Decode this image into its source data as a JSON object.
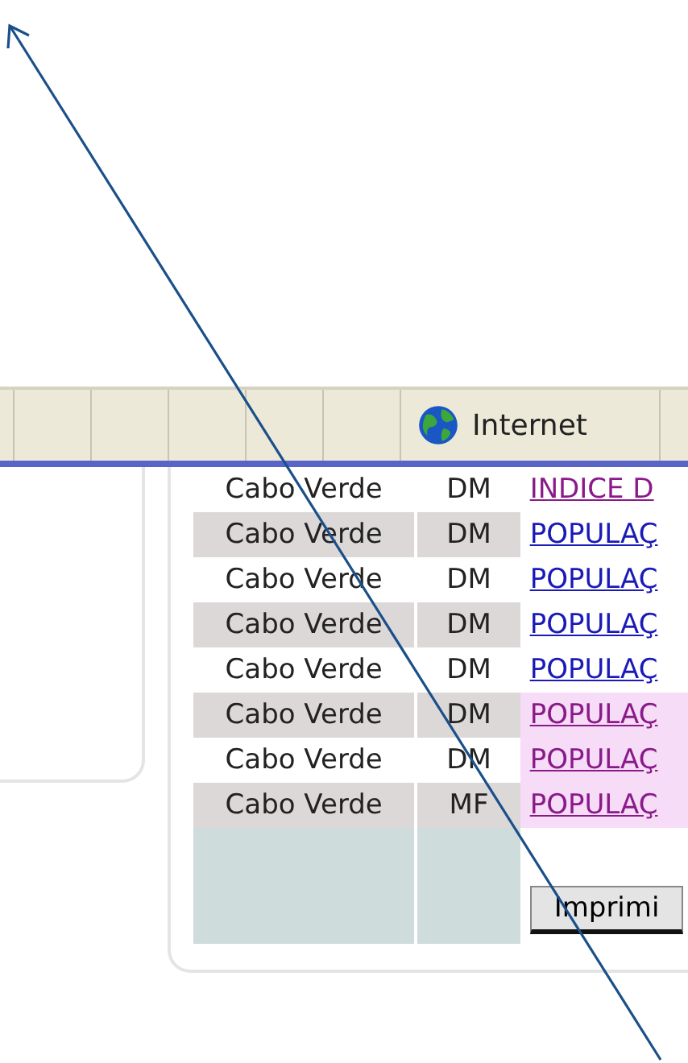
{
  "status_bar": {
    "zone": "Internet"
  },
  "table": {
    "rows": [
      {
        "country": "Cabo Verde",
        "code": "DM",
        "link": "INDICE D",
        "visited": true,
        "highlighted": false
      },
      {
        "country": "Cabo Verde",
        "code": "DM",
        "link": "POPULAÇ",
        "visited": false,
        "highlighted": false
      },
      {
        "country": "Cabo Verde",
        "code": "DM",
        "link": "POPULAÇ",
        "visited": false,
        "highlighted": false
      },
      {
        "country": "Cabo Verde",
        "code": "DM",
        "link": "POPULAÇ",
        "visited": false,
        "highlighted": false
      },
      {
        "country": "Cabo Verde",
        "code": "DM",
        "link": "POPULAÇ",
        "visited": false,
        "highlighted": false
      },
      {
        "country": "Cabo Verde",
        "code": "DM",
        "link": "POPULAÇ",
        "visited": true,
        "highlighted": true
      },
      {
        "country": "Cabo Verde",
        "code": "DM",
        "link": "POPULAÇ",
        "visited": true,
        "highlighted": true
      },
      {
        "country": "Cabo Verde",
        "code": "MF",
        "link": "POPULAÇ",
        "visited": true,
        "highlighted": true
      }
    ],
    "print_button": "Imprimi"
  }
}
